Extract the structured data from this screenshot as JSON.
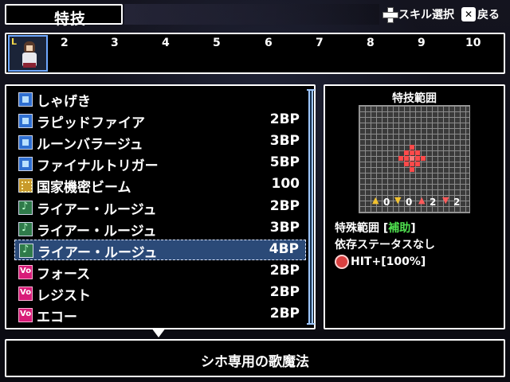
{
  "title": "特技",
  "hints": [
    {
      "icon": "dpad-icon",
      "label": "スキル選択"
    },
    {
      "icon": "x-button-icon",
      "label": "戻る"
    }
  ],
  "party_bar": {
    "slots": [
      "2",
      "3",
      "4",
      "5",
      "6",
      "7",
      "8",
      "9",
      "10"
    ],
    "leader_badge": "L"
  },
  "skills": [
    {
      "icon": "blue",
      "name": "しゃげき",
      "cost": ""
    },
    {
      "icon": "blue",
      "name": "ラピッドファイア",
      "cost": "2BP"
    },
    {
      "icon": "blue",
      "name": "ルーンバラージュ",
      "cost": "3BP"
    },
    {
      "icon": "blue",
      "name": "ファイナルトリガー",
      "cost": "5BP"
    },
    {
      "icon": "gold",
      "name": "国家機密ビーム",
      "cost": "100"
    },
    {
      "icon": "green",
      "name": "ライアー・ルージュ",
      "cost": "2BP"
    },
    {
      "icon": "green",
      "name": "ライアー・ルージュ",
      "cost": "3BP"
    },
    {
      "icon": "green",
      "name": "ライアー・ルージュ",
      "cost": "4BP",
      "selected": true
    },
    {
      "icon": "pink",
      "name": "フォース",
      "cost": "2BP"
    },
    {
      "icon": "pink",
      "name": "レジスト",
      "cost": "2BP"
    },
    {
      "icon": "pink",
      "name": "エコー",
      "cost": "2BP"
    }
  ],
  "range_panel": {
    "title": "特技範囲",
    "stats": [
      {
        "dir": "up",
        "value": "0",
        "color": "#f2c230"
      },
      {
        "dir": "down",
        "value": "0",
        "color": "#f2c230"
      },
      {
        "dir": "up",
        "value": "2",
        "color": "#ff5a5a"
      },
      {
        "dir": "down",
        "value": "2",
        "color": "#ff5a5a"
      }
    ],
    "special_label": "特殊範囲 [",
    "special_tag": "補助",
    "special_close": "]",
    "dependency": "依存ステータスなし",
    "hit": "HIT+[100%]"
  },
  "description": "シホ専用の歌魔法"
}
